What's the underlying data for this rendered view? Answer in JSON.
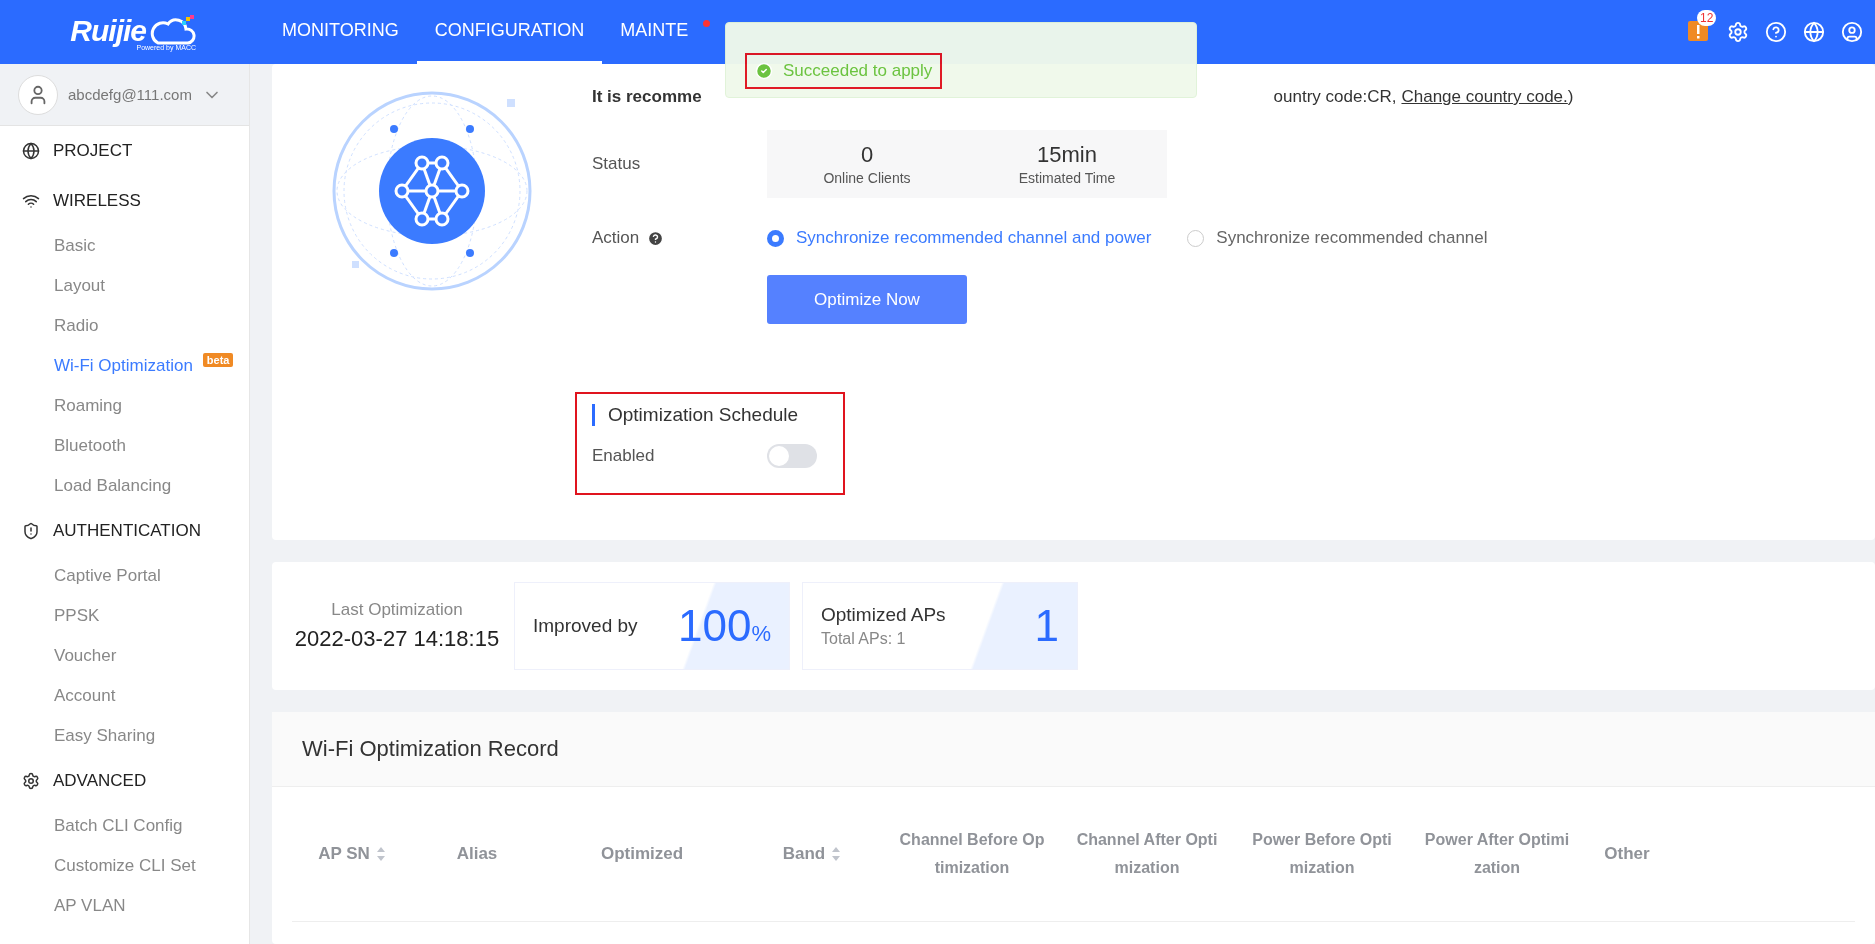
{
  "header": {
    "logo": "Ruijie",
    "logo_sub": "Powered by MACC",
    "nav": [
      {
        "label": "MONITORING",
        "selected": false
      },
      {
        "label": "CONFIGURATION",
        "selected": true
      },
      {
        "label": "MAINTE",
        "selected": false,
        "dot": true
      }
    ],
    "alert_count": "12"
  },
  "toast": {
    "message": "Succeeded to apply"
  },
  "sidebar": {
    "user": "abcdefg@111.com",
    "sections": [
      {
        "label": "PROJECT"
      },
      {
        "label": "WIRELESS",
        "items": [
          {
            "label": "Basic",
            "selected": false
          },
          {
            "label": "Layout",
            "selected": false
          },
          {
            "label": "Radio",
            "selected": false
          },
          {
            "label": "Wi-Fi Optimization",
            "selected": true,
            "badge": "beta"
          },
          {
            "label": "Roaming",
            "selected": false
          },
          {
            "label": "Bluetooth",
            "selected": false
          },
          {
            "label": "Load Balancing",
            "selected": false
          }
        ]
      },
      {
        "label": "AUTHENTICATION",
        "items": [
          {
            "label": "Captive Portal",
            "selected": false
          },
          {
            "label": "PPSK",
            "selected": false
          },
          {
            "label": "Voucher",
            "selected": false
          },
          {
            "label": "Account",
            "selected": false
          },
          {
            "label": "Easy Sharing",
            "selected": false
          }
        ]
      },
      {
        "label": "ADVANCED",
        "items": [
          {
            "label": "Batch CLI Config",
            "selected": false
          },
          {
            "label": "Customize CLI Set",
            "selected": false
          },
          {
            "label": "AP VLAN",
            "selected": false
          }
        ]
      }
    ]
  },
  "optimizer": {
    "intro_start": "It is recomme",
    "intro_end": "ountry code:CR,",
    "intro_link": "Change country code.",
    "intro_close": ")",
    "status_label": "Status",
    "status": [
      {
        "value": "0",
        "label": "Online Clients"
      },
      {
        "value": "15min",
        "label": "Estimated Time"
      }
    ],
    "action_label": "Action",
    "actions": [
      {
        "label": "Synchronize recommended channel and power",
        "selected": true
      },
      {
        "label": "Synchronize recommended channel",
        "selected": false
      }
    ],
    "button": "Optimize Now",
    "schedule": {
      "title": "Optimization Schedule",
      "label": "Enabled",
      "on": false
    }
  },
  "summary": {
    "last_label": "Last Optimization",
    "last_value": "2022-03-27 14:18:15",
    "improved_label": "Improved by",
    "improved_value": "100",
    "improved_unit": "%",
    "aps_label": "Optimized APs",
    "aps_total": "Total APs: 1",
    "aps_value": "1"
  },
  "record": {
    "title": "Wi-Fi Optimization Record",
    "columns": [
      {
        "label": "AP SN",
        "sortable": true
      },
      {
        "label": "Alias",
        "sortable": false
      },
      {
        "label": "Optimized",
        "sortable": false
      },
      {
        "label": "Band",
        "sortable": true
      },
      {
        "label": "Channel Before Optimization",
        "sortable": false
      },
      {
        "label": "Channel After Optimization",
        "sortable": false
      },
      {
        "label": "Power Before Optimization",
        "sortable": false
      },
      {
        "label": "Power After Optimization",
        "sortable": false
      },
      {
        "label": "Other",
        "sortable": false
      }
    ]
  }
}
